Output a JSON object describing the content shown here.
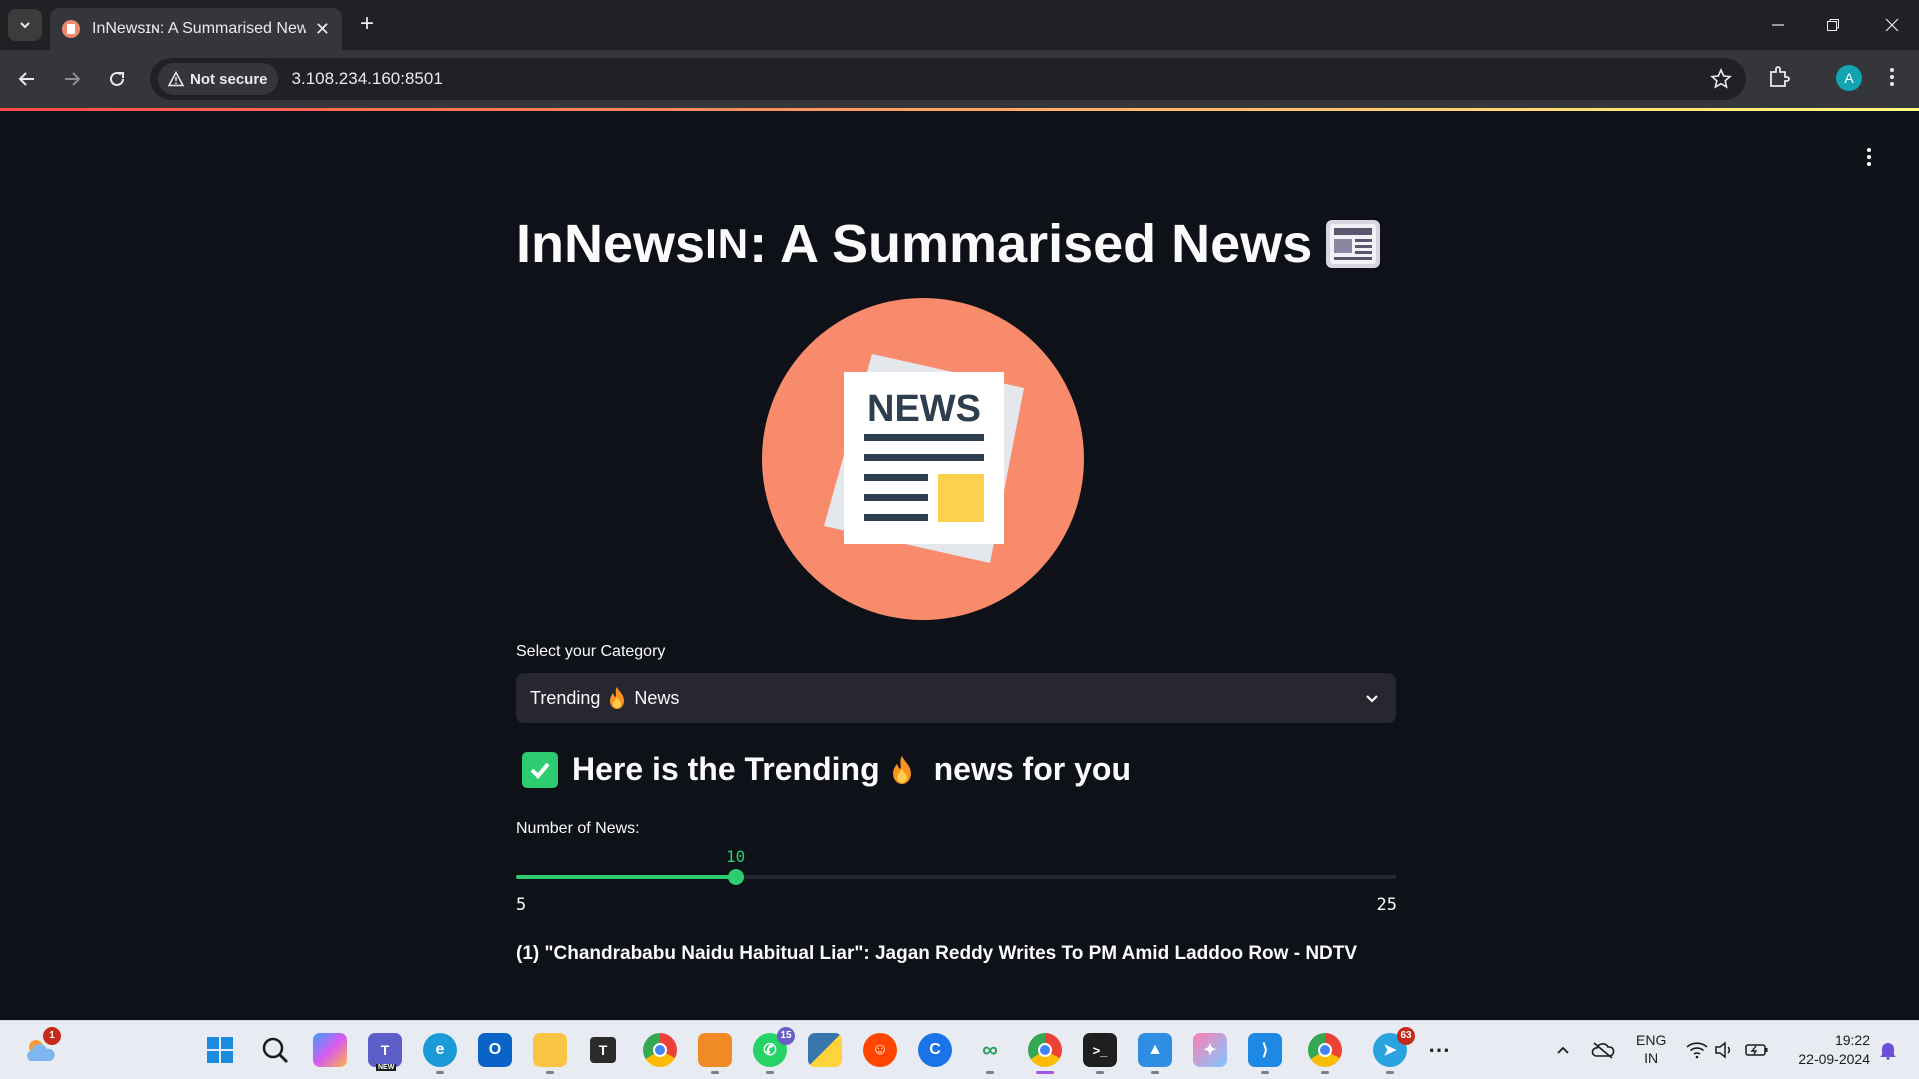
{
  "browser": {
    "tab_title": "InNewsɪɴ: A Summarised News |",
    "url": "3.108.234.160:8501",
    "security_label": "Not secure",
    "profile_initial": "A"
  },
  "app": {
    "title_prefix": "InNews",
    "title_smallcaps": "IN",
    "title_suffix": ": A Summarised News",
    "hero_text": "NEWS",
    "category_label": "Select your Category",
    "category_value_prefix": "Trending",
    "category_value_suffix": "News",
    "heading_prefix": "Here is the Trending",
    "heading_suffix": "news for you",
    "slider_label": "Number of News:",
    "slider_value": "10",
    "slider_min": "5",
    "slider_max": "25",
    "slider_level": 0.25,
    "news_items": [
      "(1) \"Chandrababu Naidu Habitual Liar\": Jagan Reddy Writes To PM Amid Laddoo Row - NDTV"
    ]
  },
  "taskbar": {
    "weather_badge": "1",
    "whatsapp_badge": "15",
    "telegram_badge": "63",
    "teams_label": "NEW",
    "lang_line1": "ENG",
    "lang_line2": "IN",
    "time": "19:22",
    "date": "22-09-2024"
  },
  "colors": {
    "accent": "#2ecc71",
    "background": "#0e1117",
    "hero_circle": "#f88b6c",
    "select_bg": "#262730"
  }
}
